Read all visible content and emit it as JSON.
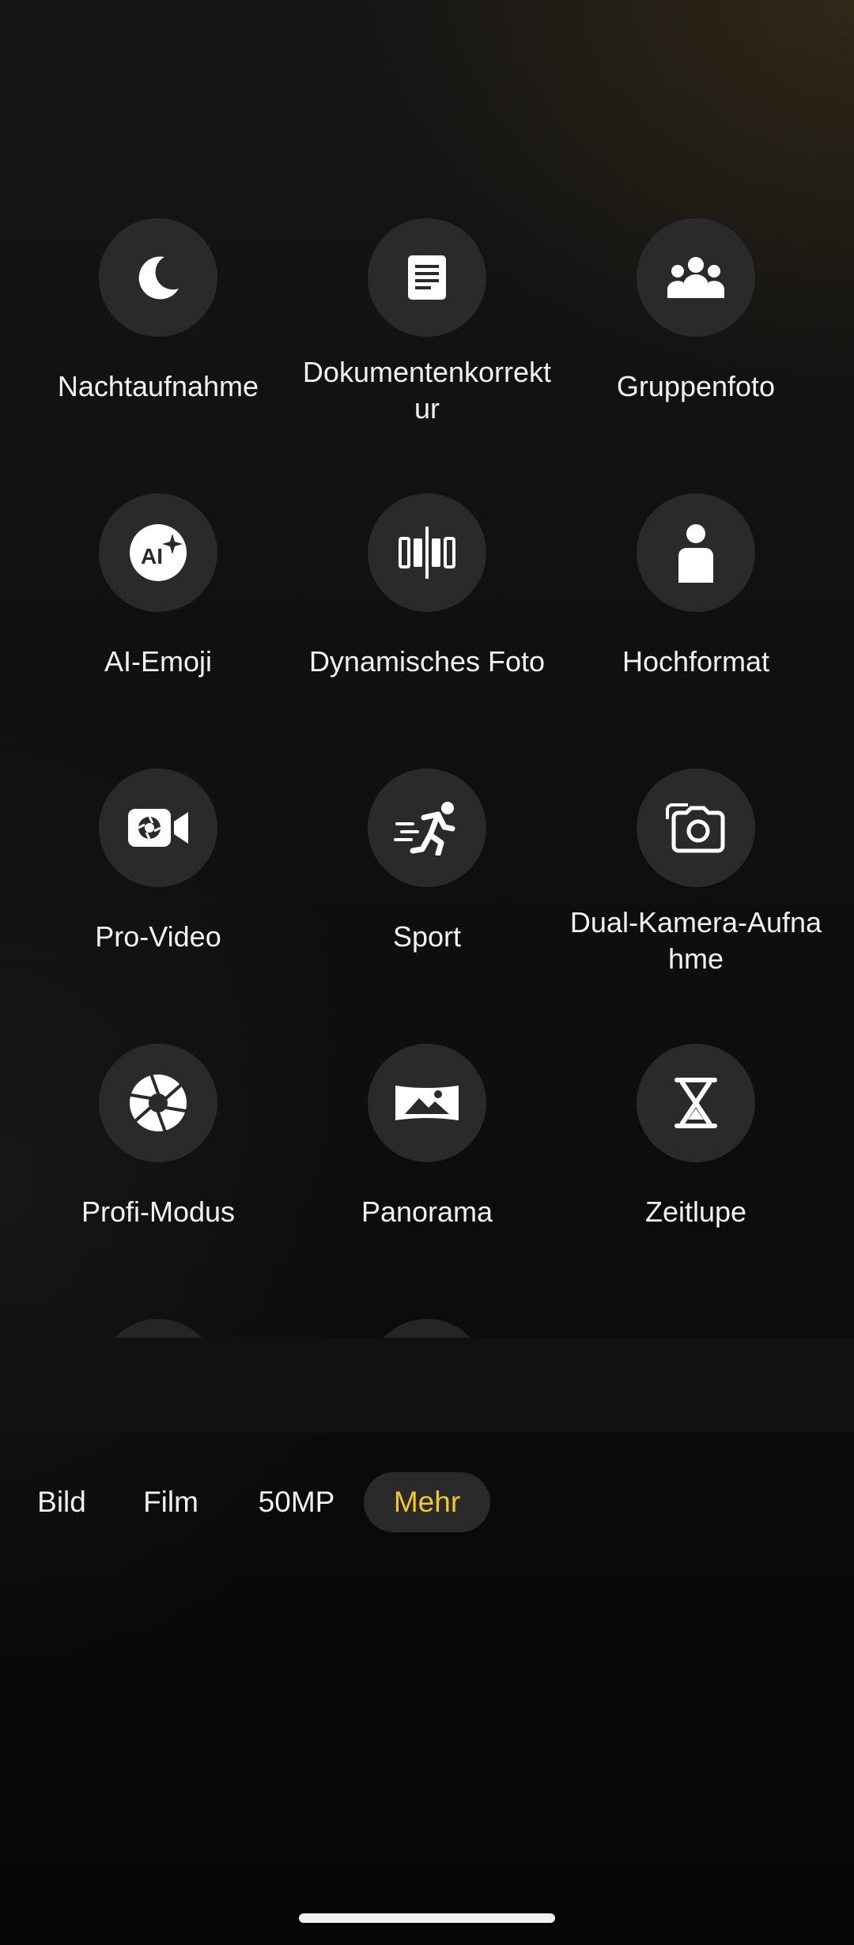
{
  "modes": [
    {
      "label": "Nachtaufnahme",
      "icon": "moon-icon"
    },
    {
      "label": "Dokumentenkorrektur",
      "icon": "document-icon"
    },
    {
      "label": "Gruppenfoto",
      "icon": "group-icon"
    },
    {
      "label": "AI-Emoji",
      "icon": "ai-emoji-icon"
    },
    {
      "label": "Dynamisches Foto",
      "icon": "dynamic-photo-icon"
    },
    {
      "label": "Hochformat",
      "icon": "portrait-person-icon"
    },
    {
      "label": "Pro-Video",
      "icon": "pro-video-icon"
    },
    {
      "label": "Sport",
      "icon": "running-person-icon"
    },
    {
      "label": "Dual-Kamera-Aufnahme",
      "icon": "dual-camera-icon"
    },
    {
      "label": "Profi-Modus",
      "icon": "aperture-icon"
    },
    {
      "label": "Panorama",
      "icon": "panorama-icon"
    },
    {
      "label": "Zeitlupe",
      "icon": "hourglass-icon"
    }
  ],
  "tabs": {
    "bild": "Bild",
    "film": "Film",
    "mp": "50MP",
    "mehr": "Mehr"
  },
  "colors": {
    "accent": "#f3c431",
    "icon_bg": "#2a2a2a",
    "text": "#f2f2f2"
  }
}
